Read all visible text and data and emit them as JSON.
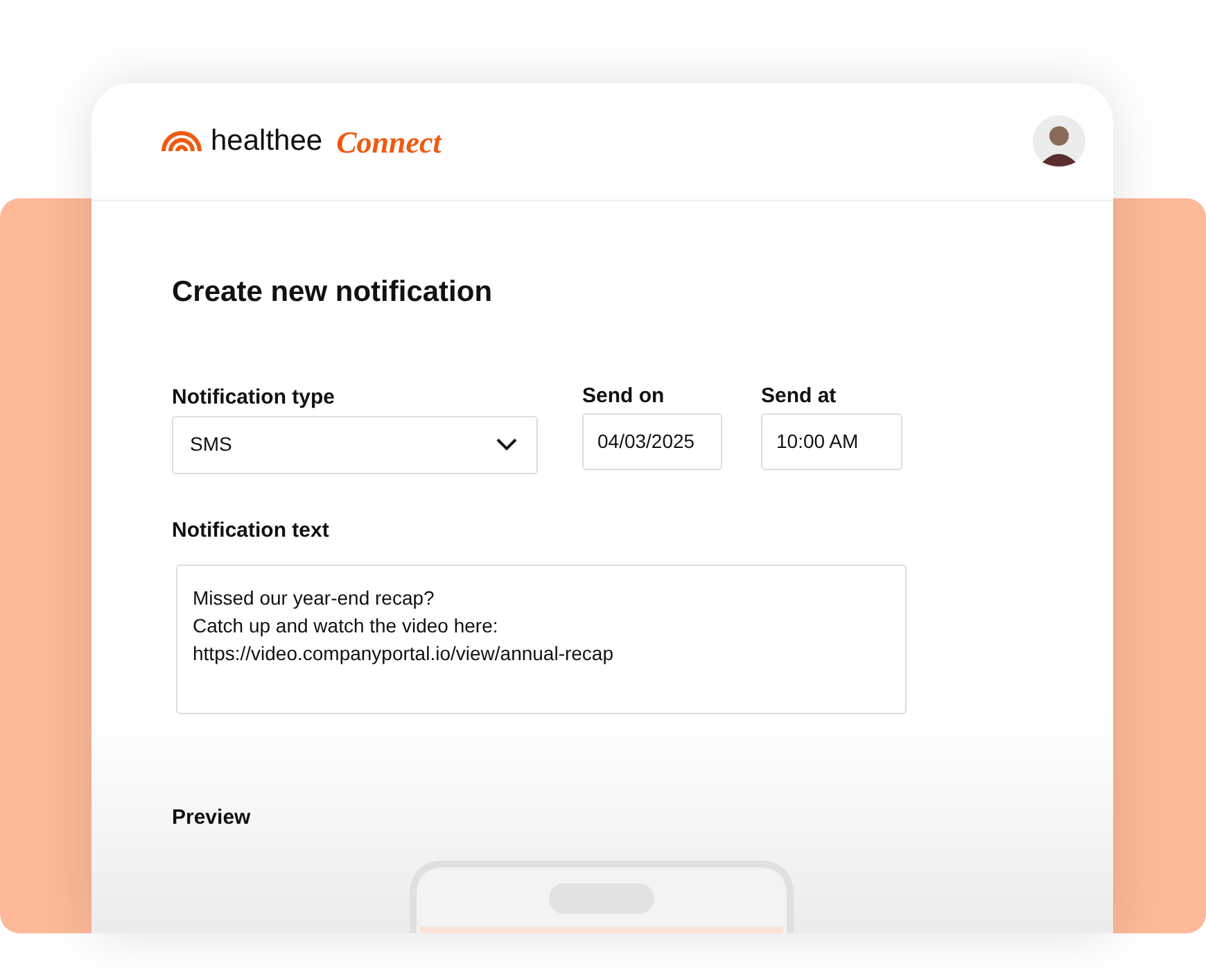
{
  "brand": {
    "name": "healthee",
    "product": "Connect"
  },
  "form": {
    "title": "Create new notification",
    "type_field": {
      "label": "Notification type",
      "value": "SMS"
    },
    "date_field": {
      "label": "Send on",
      "value": "04/03/2025"
    },
    "time_field": {
      "label": "Send at",
      "value": "10:00 AM"
    },
    "text_field": {
      "label": "Notification text",
      "value": "Missed our year-end recap?\nCatch up and watch the video here:\nhttps://video.companyportal.io/view/annual-recap"
    },
    "preview": {
      "label": "Preview"
    }
  }
}
